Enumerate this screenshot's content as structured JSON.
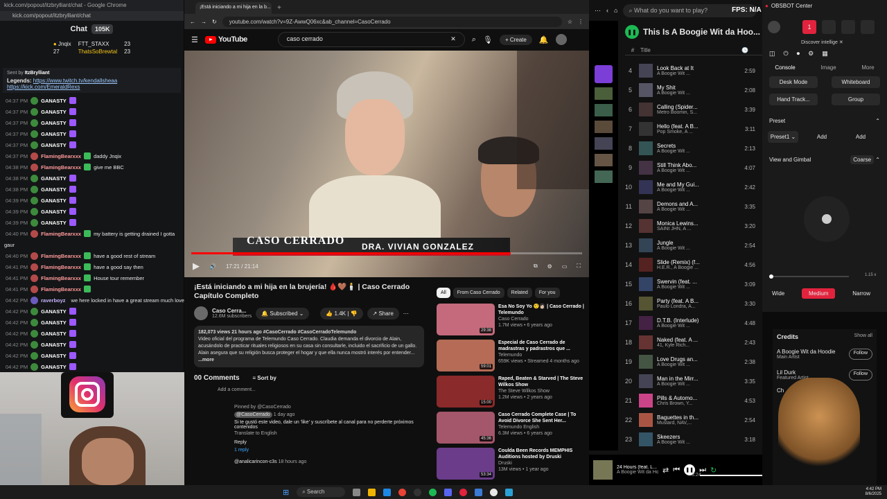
{
  "chat": {
    "window_title": "kick.com/popout/itzbrylliant/chat - Google Chrome",
    "url": "kick.com/popout/itzbrylliant/chat",
    "header": "Chat",
    "viewer_count": "105K",
    "leaderboard": [
      {
        "name": "Jnqix",
        "count": "23"
      },
      {
        "name": "FTT_STAXX",
        "count": "23"
      },
      {
        "name": "ThatsSoBrewtal",
        "count": "23"
      }
    ],
    "leaderboard_extra": "27",
    "pinned": {
      "sent_by_label": "Sent by",
      "sent_by_user": "ItzBrylliant",
      "legends_label": "Legends:",
      "link1": "https://www.twitch.tv/kendallsheaa",
      "link2": "https://kick.com/EmeraldRexs"
    },
    "messages": [
      {
        "time": "04:37 PM",
        "user": "GANASTY",
        "text": "",
        "color": "#ffffff"
      },
      {
        "time": "04:37 PM",
        "user": "GANASTY",
        "text": "",
        "color": "#ffffff"
      },
      {
        "time": "04:37 PM",
        "user": "GANASTY",
        "text": "",
        "color": "#ffffff"
      },
      {
        "time": "04:37 PM",
        "user": "GANASTY",
        "text": "",
        "color": "#ffffff"
      },
      {
        "time": "04:37 PM",
        "user": "GANASTY",
        "text": "",
        "color": "#ffffff"
      },
      {
        "time": "04:37 PM",
        "user": "FlamingBearxxx",
        "text": "daddy Jnqix",
        "color": "#ff9a9a"
      },
      {
        "time": "04:38 PM",
        "user": "FlamingBearxxx",
        "text": "give me BBC",
        "color": "#ff9a9a"
      },
      {
        "time": "04:38 PM",
        "user": "GANASTY",
        "text": "",
        "color": "#ffffff"
      },
      {
        "time": "04:38 PM",
        "user": "GANASTY",
        "text": "",
        "color": "#ffffff"
      },
      {
        "time": "04:39 PM",
        "user": "GANASTY",
        "text": "",
        "color": "#ffffff"
      },
      {
        "time": "04:39 PM",
        "user": "GANASTY",
        "text": "",
        "color": "#ffffff"
      },
      {
        "time": "04:39 PM",
        "user": "GANASTY",
        "text": "",
        "color": "#ffffff"
      },
      {
        "time": "04:40 PM",
        "user": "FlamingBearxxx",
        "text": "my battery is getting drained I gotta",
        "color": "#ff9a9a"
      },
      {
        "time": "",
        "user": "",
        "text": "gaur",
        "color": "#ffffff"
      },
      {
        "time": "04:40 PM",
        "user": "FlamingBearxxx",
        "text": "have a good rest of stream",
        "color": "#ff9a9a"
      },
      {
        "time": "04:41 PM",
        "user": "FlamingBearxxx",
        "text": "have a good say then",
        "color": "#ff9a9a"
      },
      {
        "time": "04:41 PM",
        "user": "FlamingBearxxx",
        "text": "House tour remember",
        "color": "#ff9a9a"
      },
      {
        "time": "04:41 PM",
        "user": "FlamingBearxxx",
        "text": "",
        "color": "#ff9a9a"
      },
      {
        "time": "04:42 PM",
        "user": "raverboyz",
        "text": "we here locked in have a great stream much love",
        "color": "#c7b3ff"
      },
      {
        "time": "04:42 PM",
        "user": "GANASTY",
        "text": "",
        "color": "#ffffff"
      },
      {
        "time": "04:42 PM",
        "user": "GANASTY",
        "text": "",
        "color": "#ffffff"
      },
      {
        "time": "04:42 PM",
        "user": "GANASTY",
        "text": "",
        "color": "#ffffff"
      },
      {
        "time": "04:42 PM",
        "user": "GANASTY",
        "text": "",
        "color": "#ffffff"
      },
      {
        "time": "04:42 PM",
        "user": "GANASTY",
        "text": "",
        "color": "#ffffff"
      },
      {
        "time": "04:42 PM",
        "user": "GANASTY",
        "text": "",
        "color": "#ffffff"
      }
    ]
  },
  "browser": {
    "tab_title": "¡Está iniciando a mi hija en la b...",
    "url": "youtube.com/watch?v=9Z-AwwQ06xc&ab_channel=CasoCerrado",
    "youtube_logo": "YouTube",
    "search_value": "caso cerrado",
    "create_label": "Create"
  },
  "video": {
    "show_logo": "CASO CERRADO",
    "lower_third": "DRA. VIVIAN GONZALEZ",
    "time": "17:21 / 21:14",
    "progress": 0.817,
    "title": "¡Está iniciando a mi hija en la brujería! 🩸🤎🕯️ | Caso Cerrado Capítulo Completo",
    "channel": "Caso Cerra...",
    "subscribers": "12.6M subscribers",
    "subscribed_label": "Subscribed",
    "likes": "1.4K",
    "share_label": "Share",
    "desc_stats": "182,073 views 21 hours ago #CasoCerrado #CasoCerradoTelemundo",
    "desc_body": "Video oficial del programa de Telemundo Caso Cerrado. Claudia demanda el divorcio de Alain, acusándolo de practicar rituales religiosos en su casa sin consultarle, incluido el sacrificio de un gallo. Alain asegura que su religión busca proteger el hogar y que ella nunca mostró interés por entender...",
    "desc_more": "...more",
    "comments_label": "00 Comments",
    "sort_label": "Sort by",
    "add_comment": "Add a comment...",
    "pinned_by": "Pinned by @CasoCerrado",
    "comment_user": "@CasoCerrado",
    "comment_time": "1 day ago",
    "comment_text": "Si te gustó este video, dale un 'like' y suscríbete al canal para no perderte próximos contenidos",
    "translate": "Translate to English",
    "reply_label": "Reply",
    "replies_label": "1 reply",
    "comment2_user": "@analicarincon-c3s",
    "comment2_time": "18 hours ago"
  },
  "sidebar": {
    "chips": [
      "All",
      "From Caso Cerrado",
      "Related",
      "For you"
    ],
    "recs": [
      {
        "title": "Esa No Soy Yo 🤨👩🏻 | Caso Cerrado | Telemundo",
        "channel": "Caso Cerrado",
        "meta": "1.7M views • 6 years ago",
        "duration": "29:38",
        "color": "#c46a7c"
      },
      {
        "title": "Especial de Caso Cerrado de madrastras y padrastros que ...",
        "channel": "Telemundo",
        "meta": "659K views • Streamed 4 months ago",
        "duration": "59:01",
        "color": "#b56b55"
      },
      {
        "title": "Raped, Beaten & Starved | The Steve Wilkos Show",
        "channel": "The Steve Wilkos Show",
        "meta": "1.2M views • 2 years ago",
        "duration": "15:00",
        "color": "#8b2a2a"
      },
      {
        "title": "Caso Cerrado Complete Case | To Avoid Divorce She Sent Her...",
        "channel": "Telemundo English",
        "meta": "6.3M views • 6 years ago",
        "duration": "45:36",
        "color": "#a4566a"
      },
      {
        "title": "Coulda Been Records MEMPHIS Auditions hosted by Druski",
        "channel": "Druski",
        "meta": "13M views • 1 year ago",
        "duration": "53:34",
        "color": "#6a3c8a"
      }
    ]
  },
  "spotify": {
    "search_placeholder": "What do you want to play?",
    "playlist_title": "This Is A Boogie Wit da Hoo...",
    "col_number": "#",
    "col_title": "Title",
    "fps_label": "FPS: N/A",
    "tracks": [
      {
        "n": "4",
        "title": "Look Back at It",
        "artist": "A Boogie Wit ...",
        "dur": "2:59"
      },
      {
        "n": "5",
        "title": "My Shit",
        "artist": "A Boogie Wit ...",
        "dur": "2:08"
      },
      {
        "n": "6",
        "title": "Calling (Spider...",
        "artist": "Metro Boomin, S...",
        "dur": "3:39"
      },
      {
        "n": "7",
        "title": "Hello (feat. A B...",
        "artist": "Pop Smoke, A ...",
        "dur": "3:11"
      },
      {
        "n": "8",
        "title": "Secrets",
        "artist": "A Boogie Wit ...",
        "dur": "2:13"
      },
      {
        "n": "9",
        "title": "Still Think Abo...",
        "artist": "A Boogie Wit ...",
        "dur": "4:07"
      },
      {
        "n": "10",
        "title": "Me and My Gui...",
        "artist": "A Boogie Wit ...",
        "dur": "2:42"
      },
      {
        "n": "11",
        "title": "Demons and A...",
        "artist": "A Boogie Wit ...",
        "dur": "3:35"
      },
      {
        "n": "12",
        "title": "Monica Lewins...",
        "artist": "SAINt JHN, A ...",
        "dur": "3:20"
      },
      {
        "n": "13",
        "title": "Jungle",
        "artist": "A Boogie Wit ...",
        "dur": "2:54"
      },
      {
        "n": "14",
        "title": "Slide (Remix) (f...",
        "artist": "H.E.R., A Boogie ...",
        "dur": "4:56"
      },
      {
        "n": "15",
        "title": "Swervin (feat. ...",
        "artist": "A Boogie Wit ...",
        "dur": "3:09"
      },
      {
        "n": "16",
        "title": "Party (feat. A B...",
        "artist": "Paulo Londra, A...",
        "dur": "3:30"
      },
      {
        "n": "17",
        "title": "D.T.B. (Interlude)",
        "artist": "A Boogie Wit ...",
        "dur": "4:48"
      },
      {
        "n": "18",
        "title": "Naked (feat. A ...",
        "artist": "41, Kyle Rich...",
        "dur": "2:43"
      },
      {
        "n": "19",
        "title": "Love Drugs an...",
        "artist": "A Boogie Wit ...",
        "dur": "2:38"
      },
      {
        "n": "20",
        "title": "Man in the Mirr...",
        "artist": "A Boogie Wit ...",
        "dur": "3:35"
      },
      {
        "n": "21",
        "title": "Pills & Automo...",
        "artist": "Chris Brown, Y...",
        "dur": "4:53"
      },
      {
        "n": "22",
        "title": "Baguettes in th...",
        "artist": "Mustard, NAV,...",
        "dur": "2:54"
      },
      {
        "n": "23",
        "title": "Skeezers",
        "artist": "A Boogie Wit ...",
        "dur": "3:18"
      }
    ],
    "now_playing_title": "24 Hours (feat. L...",
    "now_playing_artist": "A Boogie Wit da Ho...",
    "elapsed": "3:24",
    "green": "#1db954"
  },
  "obs": {
    "title": "OBSBOT Center",
    "badge": "1",
    "discover": "Discover intellige",
    "tabs": [
      "Console",
      "Image",
      "More"
    ],
    "desk_mode": "Desk Mode",
    "whiteboard": "Whiteboard",
    "hand_track": "Hand Track...",
    "group": "Group",
    "preset_label": "Preset",
    "preset_value": "Preset1",
    "add1": "Add",
    "add2": "Add",
    "view_gimbal": "View and Gimbal",
    "coarse": "Coarse",
    "zoom": "1.15 x",
    "fov": [
      "Wide",
      "Medium",
      "Narrow"
    ],
    "accent": "#e2233d"
  },
  "credits": {
    "title": "Credits",
    "show_all": "Show all",
    "artist1": "A Boogie Wit da Hoodie",
    "role1": "Main Artist",
    "artist2": "Lil Durk",
    "role2": "Featured Artist",
    "follow": "Follow",
    "partial": "Ch"
  },
  "taskbar": {
    "search": "Search",
    "time": "4:42 PM",
    "date": "8/6/2025"
  }
}
